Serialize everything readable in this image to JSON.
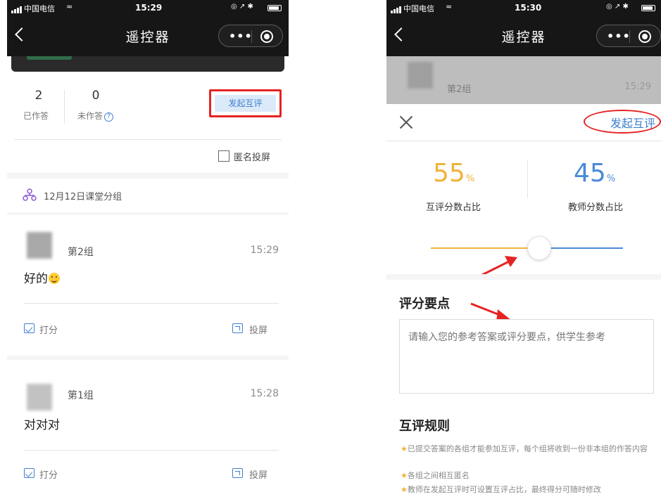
{
  "left": {
    "status": {
      "carrier": "中国电信",
      "time": "15:29"
    },
    "nav": {
      "title": "遥控器"
    },
    "stats": {
      "answered_count": "2",
      "answered_label": "已作答",
      "unanswered_count": "0",
      "unanswered_label": "未作答"
    },
    "start_peer_review": "发起互评",
    "anonymous_label": "匿名投屏",
    "session_label": "12月12日课堂分组",
    "groups": [
      {
        "name": "第2组",
        "time": "15:29",
        "message": "好的",
        "score_label": "打分",
        "project_label": "投屏"
      },
      {
        "name": "第1组",
        "time": "15:28",
        "message": "对对对",
        "score_label": "打分",
        "project_label": "投屏"
      }
    ]
  },
  "right": {
    "status": {
      "carrier": "中国电信",
      "time": "15:30"
    },
    "nav": {
      "title": "遥控器"
    },
    "behind": {
      "group_name": "第2组",
      "time": "15:29"
    },
    "start_peer_review": "发起互评",
    "peer_percent": "55",
    "peer_label": "互评分数占比",
    "teacher_percent": "45",
    "teacher_label": "教师分数占比",
    "percent_sign": "%",
    "slider_value": 0.55,
    "key_points_title": "评分要点",
    "key_points_placeholder": "请输入您的参考答案或评分要点，供学生参考",
    "rules_title": "互评规则",
    "rules": [
      "已提交答案的各组才能参加互评，每个组将收到一份非本组的作答内容",
      "各组之间相互匿名",
      "教师在发起互评时可设置互评占比，最终得分可随时修改"
    ],
    "colors": {
      "peer": "#f0b33a",
      "teacher": "#4a8ad8",
      "highlight": "#e62323"
    }
  }
}
